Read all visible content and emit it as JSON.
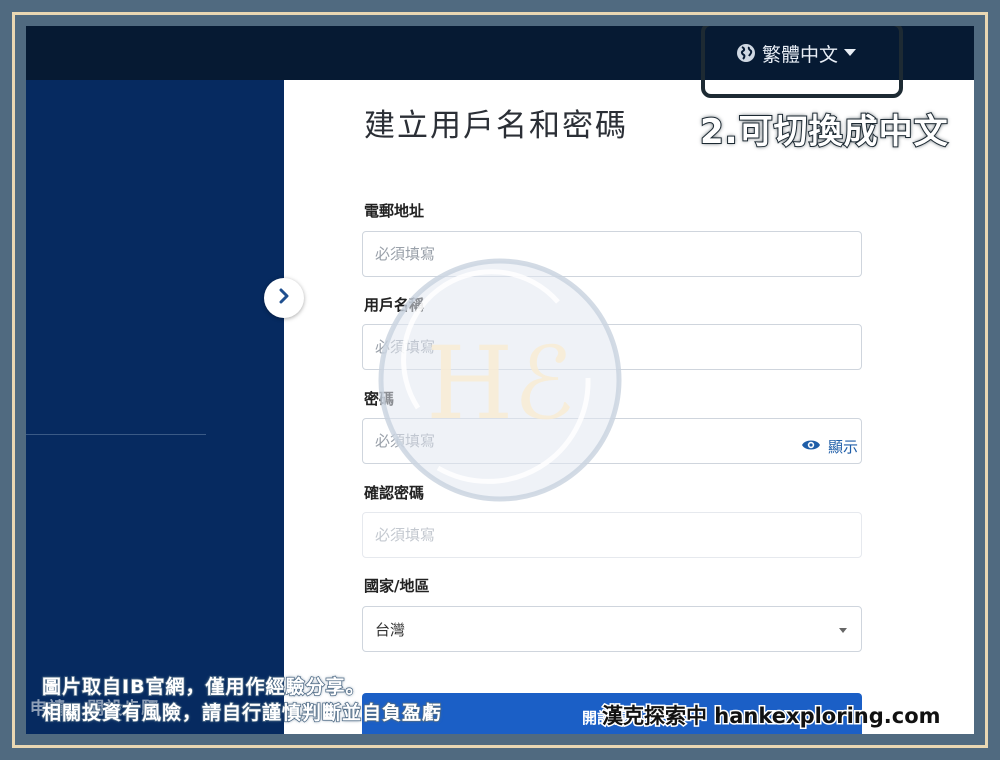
{
  "header": {
    "language_label": "繁體中文"
  },
  "annotation": {
    "text": "2.可切換成中文"
  },
  "form": {
    "title": "建立用戶名和密碼",
    "email": {
      "label": "電郵地址",
      "placeholder": "必須填寫"
    },
    "username": {
      "label": "用戶名稱",
      "placeholder": "必須填寫"
    },
    "password": {
      "label": "密碼",
      "placeholder": "必須填寫",
      "show_label": "顯示"
    },
    "confirm_password": {
      "label": "確認密碼",
      "placeholder": "必須填寫"
    },
    "country": {
      "label": "國家/地區",
      "selected": "台灣"
    },
    "submit_label": "開設帳戶"
  },
  "sidebar": {
    "faded_text": "申請 · 開設步驟"
  },
  "overlay": {
    "disclaimer_line1": "圖片取自IB官網，僅用作經驗分享。",
    "disclaimer_line2": "相關投資有風險，請自行謹慎判斷並自負盈虧",
    "brand_credit": "漢克探索中 hankexploring.com",
    "watermark_letters": "Hℰ"
  },
  "colors": {
    "topbar": "#061a33",
    "sidebar": "#062a60",
    "accent": "#1b5fc6",
    "frame": "#506a80"
  },
  "icons": {
    "language": "globe-icon",
    "dropdown": "caret-down-icon",
    "sidebar_toggle": "chevron-right-icon",
    "show_password": "eye-icon"
  }
}
